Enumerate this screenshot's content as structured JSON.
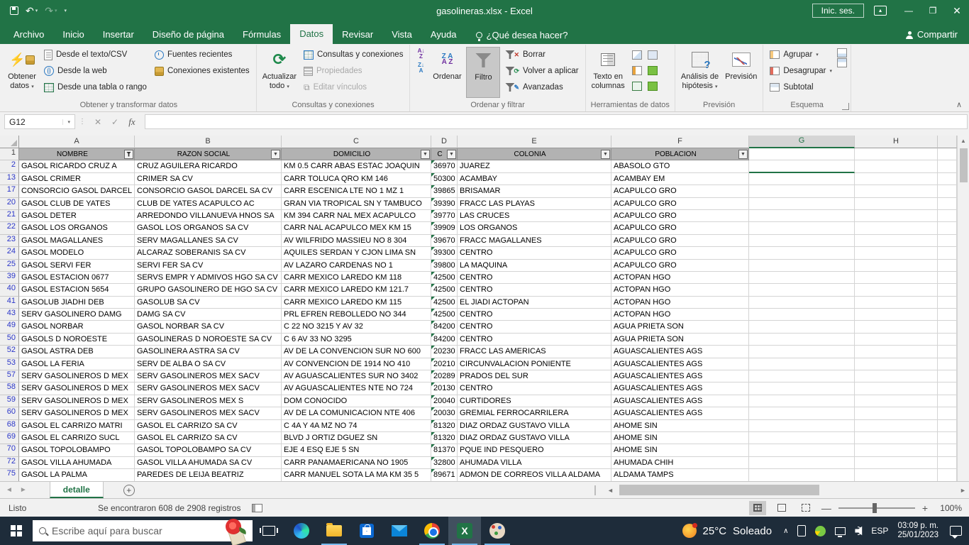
{
  "titlebar": {
    "title": "gasolineras.xlsx  -  Excel",
    "signin": "Inic. ses."
  },
  "tabs": {
    "items": [
      "Archivo",
      "Inicio",
      "Insertar",
      "Diseño de página",
      "Fórmulas",
      "Datos",
      "Revisar",
      "Vista",
      "Ayuda"
    ],
    "active": "Datos",
    "search": "¿Qué desea hacer?",
    "share": "Compartir"
  },
  "ribbon": {
    "obtener_l1": "Obtener",
    "obtener_l2": "datos",
    "desde_texto": "Desde el texto/CSV",
    "desde_web": "Desde la web",
    "desde_tabla": "Desde una tabla o rango",
    "fuentes": "Fuentes recientes",
    "conexiones": "Conexiones existentes",
    "grupo_obtener": "Obtener y transformar datos",
    "actualizar_l1": "Actualizar",
    "actualizar_l2": "todo",
    "consultas": "Consultas y conexiones",
    "propiedades": "Propiedades",
    "editar_vinculos": "Editar vínculos",
    "grupo_consultas": "Consultas y conexiones",
    "ordenar": "Ordenar",
    "filtro": "Filtro",
    "borrar": "Borrar",
    "volver": "Volver a aplicar",
    "avanzadas": "Avanzadas",
    "grupo_ordenar": "Ordenar y filtrar",
    "texto_l1": "Texto en",
    "texto_l2": "columnas",
    "grupo_herramientas": "Herramientas de datos",
    "analisis_l1": "Análisis de",
    "analisis_l2": "hipótesis",
    "prevision": "Previsión",
    "grupo_prevision": "Previsión",
    "agrupar": "Agrupar",
    "desagrupar": "Desagrupar",
    "subtotal": "Subtotal",
    "grupo_esquema": "Esquema"
  },
  "formula": {
    "cell_ref": "G12",
    "fx": "fx"
  },
  "grid": {
    "col_letters": [
      "A",
      "B",
      "C",
      "D",
      "E",
      "F",
      "G",
      "H"
    ],
    "selected_col": "G",
    "headers": [
      "NOMBRE",
      "RAZON SOCIAL",
      "DOMICILIO",
      "C",
      "COLONIA",
      "POBLACION"
    ],
    "rows": [
      {
        "n": "2",
        "cells": [
          "GASOL RICARDO CRUZ A",
          "CRUZ AGUILERA RICARDO",
          "KM 0.5 CARR ABAS ESTAC JOAQUIN",
          "36970",
          "JUAREZ",
          "ABASOLO GTO"
        ]
      },
      {
        "n": "13",
        "cells": [
          "GASOL CRIMER",
          "CRIMER SA CV",
          "CARR TOLUCA QRO KM 146",
          "50300",
          "ACAMBAY",
          "ACAMBAY EM"
        ]
      },
      {
        "n": "17",
        "cells": [
          "CONSORCIO GASOL DARCEL",
          "CONSORCIO GASOL DARCEL SA CV",
          "CARR ESCENICA LTE NO 1 MZ 1",
          "39865",
          "BRISAMAR",
          "ACAPULCO GRO"
        ]
      },
      {
        "n": "20",
        "cells": [
          "GASOL CLUB DE YATES",
          "CLUB DE YATES ACAPULCO AC",
          "GRAN VIA TROPICAL SN Y TAMBUCO",
          "39390",
          "FRACC LAS PLAYAS",
          "ACAPULCO GRO"
        ]
      },
      {
        "n": "21",
        "cells": [
          "GASOL DETER",
          "ARREDONDO VILLANUEVA HNOS SA",
          "KM 394 CARR NAL MEX ACAPULCO",
          "39770",
          "LAS CRUCES",
          "ACAPULCO GRO"
        ]
      },
      {
        "n": "22",
        "cells": [
          "GASOL LOS ORGANOS",
          "GASOL LOS ORGANOS SA CV",
          "CARR NAL ACAPULCO  MEX KM 15",
          "39909",
          "LOS ORGANOS",
          "ACAPULCO GRO"
        ]
      },
      {
        "n": "23",
        "cells": [
          "GASOL MAGALLANES",
          "SERV MAGALLANES SA CV",
          "AV WILFRIDO MASSIEU NO 8 304",
          "39670",
          "FRACC MAGALLANES",
          "ACAPULCO GRO"
        ]
      },
      {
        "n": "24",
        "cells": [
          "GASOL MODELO",
          "ALCARAZ SOBERANIS SA CV",
          "AQUILES SERDAN Y CJON LIMA SN",
          "39300",
          "CENTRO",
          "ACAPULCO GRO"
        ]
      },
      {
        "n": "25",
        "cells": [
          "GASOL SERVI FER",
          "SERVI FER SA CV",
          "AV LAZARO CARDENAS NO 1",
          "39800",
          "LA MAQUINA",
          "ACAPULCO GRO"
        ]
      },
      {
        "n": "39",
        "cells": [
          "GASOL ESTACION 0677",
          "SERVS EMPR Y ADMIVOS HGO SA CV",
          "CARR MEXICO LAREDO KM 118",
          "42500",
          "CENTRO",
          "ACTOPAN HGO"
        ]
      },
      {
        "n": "40",
        "cells": [
          "GASOL ESTACION 5654",
          "GRUPO GASOLINERO DE HGO SA CV",
          "CARR MEXICO LAREDO KM 121.7",
          "42500",
          "CENTRO",
          "ACTOPAN HGO"
        ]
      },
      {
        "n": "41",
        "cells": [
          "GASOLUB JIADHI DEB",
          "GASOLUB SA CV",
          "CARR MEXICO LAREDO KM 115",
          "42500",
          "EL JIADI ACTOPAN",
          "ACTOPAN HGO"
        ]
      },
      {
        "n": "43",
        "cells": [
          "SERV GASOLINERO DAMG",
          "DAMG SA CV",
          "PRL EFREN REBOLLEDO NO 344",
          "42500",
          "CENTRO",
          "ACTOPAN HGO"
        ]
      },
      {
        "n": "49",
        "cells": [
          "GASOL NORBAR",
          "GASOL NORBAR SA CV",
          "C 22 NO 3215 Y AV 32",
          "84200",
          "CENTRO",
          "AGUA PRIETA SON"
        ]
      },
      {
        "n": "50",
        "cells": [
          "GASOLS D NOROESTE",
          "GASOLINERAS D NOROESTE SA CV",
          "C 6 AV 33 NO 3295",
          "84200",
          "CENTRO",
          "AGUA PRIETA SON"
        ]
      },
      {
        "n": "52",
        "cells": [
          "GASOL ASTRA DEB",
          "GASOLINERA ASTRA SA CV",
          "AV DE LA CONVENCION SUR NO 600",
          "20230",
          "FRACC LAS AMERICAS",
          "AGUASCALIENTES AGS"
        ]
      },
      {
        "n": "53",
        "cells": [
          "GASOL LA FERIA",
          "SERV DE ALBA O SA CV",
          "AV CONVENCION DE 1914 NO 410",
          "20210",
          "CIRCUNVALACION PONIENTE",
          "AGUASCALIENTES AGS"
        ]
      },
      {
        "n": "57",
        "cells": [
          "SERV GASOLINEROS D MEX",
          "SERV GASOLINEROS MEX SACV",
          "AV AGUASCALIENTES SUR NO 3402",
          "20289",
          "PRADOS DEL SUR",
          "AGUASCALIENTES AGS"
        ]
      },
      {
        "n": "58",
        "cells": [
          "SERV GASOLINEROS D MEX",
          "SERV GASOLINEROS MEX SACV",
          "AV AGUASCALIENTES NTE NO 724",
          "20130",
          "CENTRO",
          "AGUASCALIENTES AGS"
        ]
      },
      {
        "n": "59",
        "cells": [
          "SERV GASOLINEROS D MEX",
          "SERV GASOLINEROS MEX S",
          "DOM CONOCIDO",
          "20040",
          "CURTIDORES",
          "AGUASCALIENTES AGS"
        ]
      },
      {
        "n": "60",
        "cells": [
          "SERV GASOLINEROS D MEX",
          "SERV GASOLINEROS MEX SACV",
          "AV DE LA COMUNICACION NTE 406",
          "20030",
          "GREMIAL FERROCARRILERA",
          "AGUASCALIENTES AGS"
        ]
      },
      {
        "n": "68",
        "cells": [
          "GASOL EL CARRIZO MATRI",
          "GASOL EL CARRIZO SA CV",
          "C 4A Y 4A MZ NO 74",
          "81320",
          "DIAZ ORDAZ GUSTAVO VILLA",
          "AHOME SIN"
        ]
      },
      {
        "n": "69",
        "cells": [
          "GASOL EL CARRIZO SUCL",
          "GASOL EL CARRIZO SA CV",
          "BLVD J ORTIZ DGUEZ SN",
          "81320",
          "DIAZ ORDAZ GUSTAVO VILLA",
          "AHOME SIN"
        ]
      },
      {
        "n": "70",
        "cells": [
          "GASOL TOPOLOBAMPO",
          "GASOL TOPOLOBAMPO SA CV",
          "EJE 4 ESQ EJE 5 SN",
          "81370",
          "PQUE IND PESQUERO",
          "AHOME SIN"
        ]
      },
      {
        "n": "72",
        "cells": [
          "GASOL VILLA AHUMADA",
          "GASOL VILLA AHUMADA SA CV",
          "CARR PANAMAERICANA NO 1905",
          "32800",
          "AHUMADA VILLA",
          "AHUMADA CHIH"
        ]
      },
      {
        "n": "75",
        "cells": [
          "GASOL LA PALMA",
          "PAREDES DE LEIJA BEATRIZ",
          "CARR MANUEL SOTA LA MA KM 35 5",
          "89671",
          "ADMON DE CORREOS VILLA ALDAMA",
          "ALDAMA TAMPS"
        ]
      }
    ]
  },
  "sheet": {
    "tab": "detalle"
  },
  "status": {
    "mode": "Listo",
    "message": "Se encontraron 608 de 2908 registros",
    "zoom": "100%"
  },
  "taskbar": {
    "search": "Escribe aquí para buscar",
    "temp": "25°C",
    "weather": "Soleado",
    "lang": "ESP",
    "time": "03:09 p. m.",
    "date": "25/01/2023"
  }
}
